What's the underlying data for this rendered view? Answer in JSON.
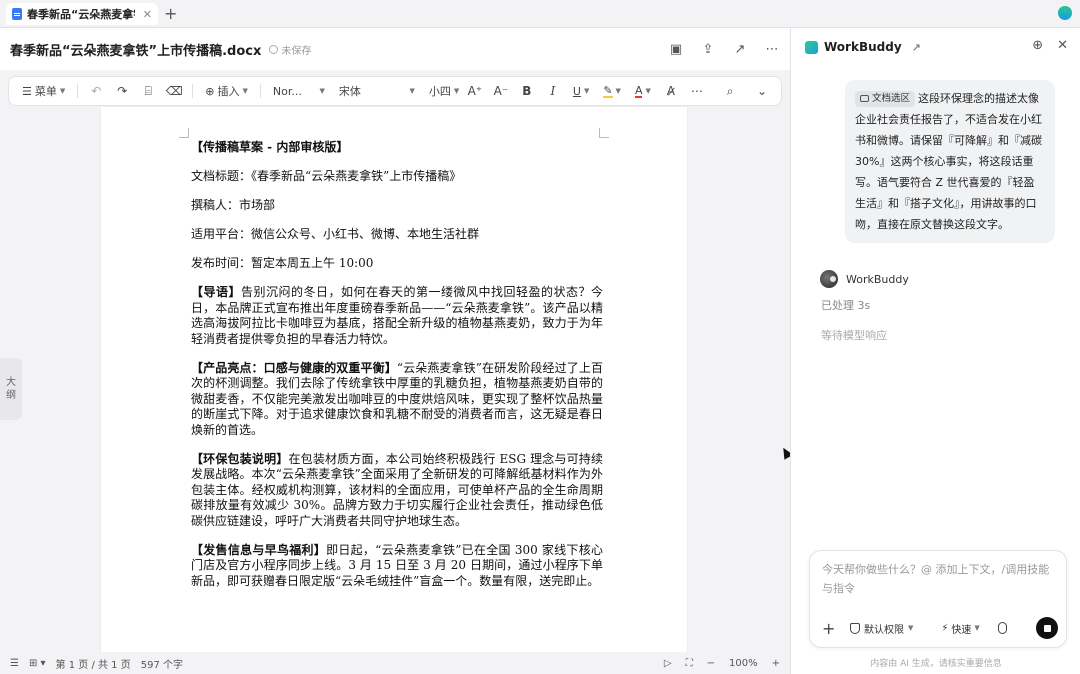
{
  "tabbar": {
    "tab_title": "春季新品“云朵燕麦拿铁”",
    "tab_close": "✕",
    "add_tab": "+"
  },
  "doc": {
    "title": "春季新品“云朵燕麦拿铁”上市传播稿.docx",
    "save_status": "未保存"
  },
  "toolbar": {
    "menu": "菜单",
    "insert": "插入",
    "font_style": "Nor...",
    "font_family": "宋体",
    "font_size": "小四"
  },
  "outline": {
    "line1": "大",
    "line2": "纲"
  },
  "content": {
    "heading": "【传播稿草案 - 内部审核版】",
    "meta": [
      {
        "label": "文档标题：",
        "value": "《春季新品“云朵燕麦拿铁”上市传播稿》"
      },
      {
        "label": "撰稿人：",
        "value": "市场部"
      },
      {
        "label": "适用平台：",
        "value": "微信公众号、小红书、微博、本地生活社群"
      },
      {
        "label": "发布时间：",
        "value": "暂定本周五上午 10:00"
      }
    ],
    "sections": [
      {
        "title": "【导语】",
        "text": "告别沉闷的冬日，如何在春天的第一缕微风中找回轻盈的状态？今日，本品牌正式宣布推出年度重磅春季新品——“云朵燕麦拿铁”。该产品以精选高海拔阿拉比卡咖啡豆为基底，搭配全新升级的植物基燕麦奶，致力于为年轻消费者提供零负担的早春活力特饮。"
      },
      {
        "title": "【产品亮点：口感与健康的双重平衡】",
        "text": "“云朵燕麦拿铁”在研发阶段经过了上百次的杯测调整。我们去除了传统拿铁中厚重的乳糖负担，植物基燕麦奶自带的微甜麦香，不仅能完美激发出咖啡豆的中度烘焙风味，更实现了整杯饮品热量的断崖式下降。对于追求健康饮食和乳糖不耐受的消费者而言，这无疑是春日焕新的首选。"
      },
      {
        "title": "【环保包装说明】",
        "text": "在包装材质方面，本公司始终积极践行 ESG 理念与可持续发展战略。本次“云朵燕麦拿铁”全面采用了全新研发的可降解纸基材料作为外包装主体。经权威机构测算，该材料的全面应用，可使单杯产品的全生命周期碳排放量有效减少 30%。品牌方致力于切实履行企业社会责任，推动绿色低碳供应链建设，呼吁广大消费者共同守护地球生态。"
      },
      {
        "title": "【发售信息与早鸟福利】",
        "text": "即日起，“云朵燕麦拿铁”已在全国 300 家线下核心门店及官方小程序同步上线。3 月 15 日至 3 月 20 日期间，通过小程序下单新品，即可获赠春日限定版“云朵毛绒挂件”盲盒一个。数量有限，送完即止。"
      }
    ]
  },
  "statusbar": {
    "page": "第 1 页 / 共 1 页",
    "word_count": "597 个字",
    "zoom": "100%"
  },
  "panel": {
    "title": "WorkBuddy",
    "user_message": {
      "chip": "文档选区",
      "text": "这段环保理念的描述太像企业社会责任报告了，不适合发在小红书和微博。请保留『可降解』和『减碳30%』这两个核心事实，将这段话重写。语气要符合 Z 世代喜爱的『轻盈生活』和『搭子文化』，用讲故事的口吻，直接在原文替换这段文字。"
    },
    "bot_name": "WorkBuddy",
    "bot_status": "已处理 3s",
    "bot_wait": "等待模型响应",
    "composer_placeholder": "今天帮你做些什么？@ 添加上下文，/调用技能与指令",
    "permission": "默认权限",
    "speed": "快速",
    "disclaimer": "内容由 AI 生成，请核实重要信息"
  }
}
